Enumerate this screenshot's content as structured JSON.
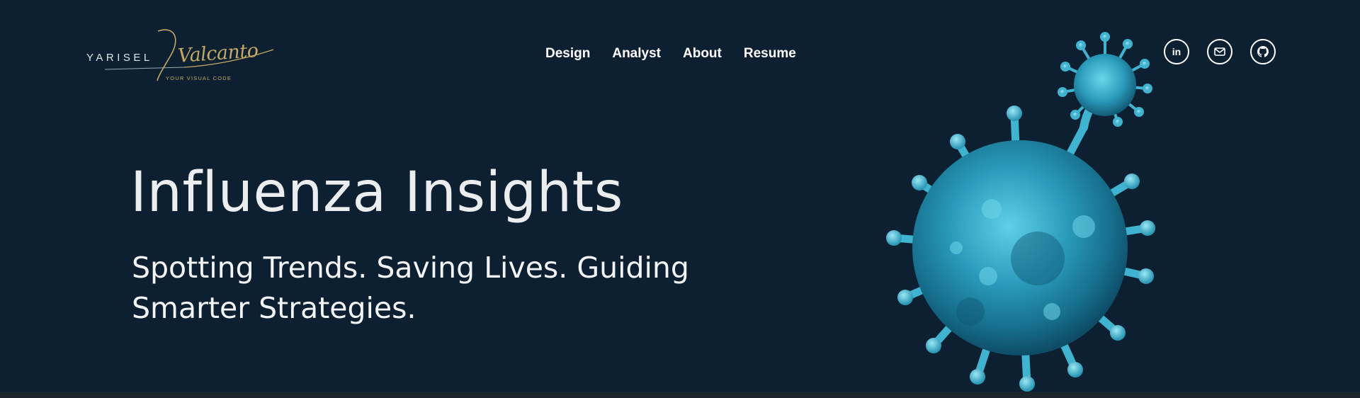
{
  "logo": {
    "first_name": "YARISEL",
    "script_name": "Valcanto",
    "tagline": "YOUR VISUAL CODE"
  },
  "nav": {
    "items": [
      "Design",
      "Analyst",
      "About",
      "Resume"
    ]
  },
  "social": {
    "linkedin_glyph": "in",
    "items": [
      {
        "icon": "linkedin-icon"
      },
      {
        "icon": "mail-icon"
      },
      {
        "icon": "github-icon"
      }
    ]
  },
  "hero": {
    "title": "Influenza Insights",
    "subtitle": "Spotting Trends. Saving Lives. Guiding Smarter Strategies."
  },
  "colors": {
    "background": "#0c2032",
    "accent_gold": "#c6a863",
    "virus_cyan": "#3fb3cf",
    "text": "#ffffff"
  }
}
